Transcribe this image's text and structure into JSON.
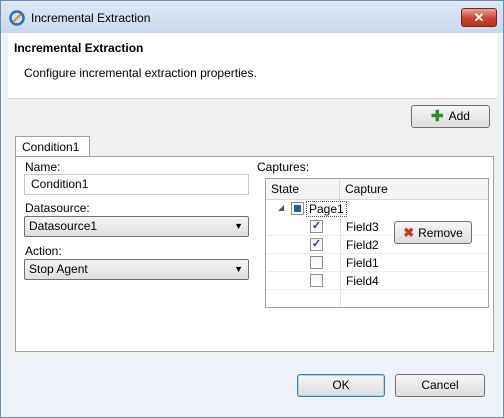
{
  "window": {
    "title": "Incremental Extraction",
    "close_label": "✕"
  },
  "header": {
    "title": "Incremental Extraction",
    "description": "Configure incremental extraction properties."
  },
  "toolbar": {
    "add_label": "Add",
    "add_icon": "plus-icon"
  },
  "tabs": [
    {
      "label": "Condition1",
      "selected": true
    }
  ],
  "form": {
    "name_label": "Name:",
    "name_value": "Condition1",
    "datasource_label": "Datasource:",
    "datasource_value": "Datasource1",
    "action_label": "Action:",
    "action_value": "Stop Agent"
  },
  "captures": {
    "label": "Captures:",
    "columns": [
      "State",
      "Capture"
    ],
    "tree": {
      "label": "Page1",
      "expanded": true,
      "state": "partial"
    },
    "rows": [
      {
        "label": "Field3",
        "checked": true
      },
      {
        "label": "Field2",
        "checked": true
      },
      {
        "label": "Field1",
        "checked": false
      },
      {
        "label": "Field4",
        "checked": false
      }
    ],
    "remove_label": "Remove",
    "remove_icon": "x-icon"
  },
  "footer": {
    "ok_label": "OK",
    "cancel_label": "Cancel"
  },
  "colors": {
    "accent": "#2b5aa8",
    "close": "#c7432b"
  }
}
